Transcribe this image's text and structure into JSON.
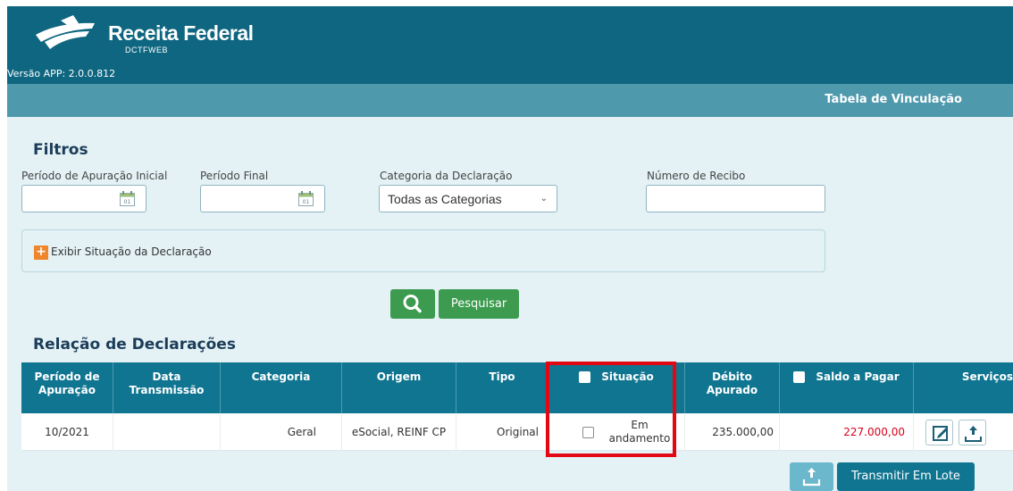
{
  "header": {
    "brand_title": "Receita Federal",
    "brand_subtitle": "DCTFWEB",
    "app_version": "Versão APP: 2.0.0.812",
    "color": "#0e6680"
  },
  "subbar": {
    "title": "Tabela de Vinculação",
    "color": "#4f99ad"
  },
  "filters": {
    "title": "Filtros",
    "period_start_label": "Período de Apuração Inicial",
    "period_start_value": "",
    "period_end_label": "Período Final",
    "period_end_value": "",
    "category_label": "Categoria da Declaração",
    "category_value": "Todas as Categorias",
    "receipt_label": "Número de Recibo",
    "receipt_value": "",
    "calendar_day": "01",
    "show_status_label": "Exibir Situação da Declaração",
    "search_label": "Pesquisar"
  },
  "declarations": {
    "title": "Relação de Declarações",
    "columns": {
      "periodo": "Período de Apuração",
      "data_transmissao": "Data Transmissão",
      "categoria": "Categoria",
      "origem": "Origem",
      "tipo": "Tipo",
      "situacao": "Situação",
      "debito": "Débito Apurado",
      "saldo": "Saldo a Pagar",
      "servicos": "Serviços"
    },
    "rows": [
      {
        "periodo": "10/2021",
        "data_transmissao": "",
        "categoria": "Geral",
        "origem": "eSocial, REINF CP",
        "tipo": "Original",
        "situacao": "Em andamento",
        "debito": "235.000,00",
        "saldo": "227.000,00"
      }
    ],
    "batch_transmit_label": "Transmitir Em Lote"
  },
  "colors": {
    "primary": "#107590",
    "success": "#3c9b4e",
    "accent_orange": "#f0862c",
    "balance_red": "#d6001c",
    "highlight": "#e30613"
  }
}
